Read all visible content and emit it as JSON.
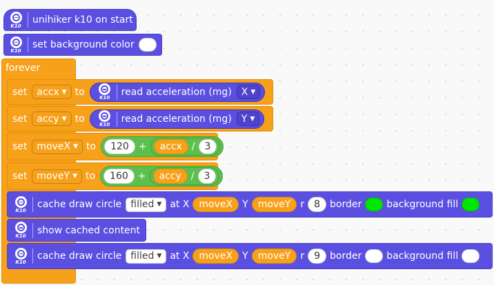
{
  "k10_icon_label": "K10",
  "hat": {
    "label": "unihiker k10 on start"
  },
  "set_bg": {
    "label": "set background color",
    "color": "#ffffff"
  },
  "forever": {
    "label": "forever"
  },
  "set_accx": {
    "set": "set",
    "var": "accx",
    "to": "to",
    "reporter_label": "read acceleration (mg)",
    "axis": "X"
  },
  "set_accy": {
    "set": "set",
    "var": "accy",
    "to": "to",
    "reporter_label": "read acceleration (mg)",
    "axis": "Y"
  },
  "set_movex": {
    "set": "set",
    "var": "moveX",
    "to": "to",
    "a": "120",
    "plus": "+",
    "b": "accx",
    "div": "/",
    "c": "3"
  },
  "set_movey": {
    "set": "set",
    "var": "moveY",
    "to": "to",
    "a": "160",
    "plus": "+",
    "b": "accy",
    "div": "/",
    "c": "3"
  },
  "circle1": {
    "label": "cache draw circle",
    "mode": "filled",
    "atx": "at X",
    "x": "moveX",
    "y_lbl": "Y",
    "y": "moveY",
    "r_lbl": "r",
    "r": "8",
    "border_lbl": "border",
    "border_color": "#00e600",
    "fill_lbl": "background fill",
    "fill_color": "#00e600"
  },
  "show_cached": {
    "label": "show cached content"
  },
  "circle2": {
    "label": "cache draw circle",
    "mode": "filled",
    "atx": "at X",
    "x": "moveX",
    "y_lbl": "Y",
    "y": "moveY",
    "r_lbl": "r",
    "r": "9",
    "border_lbl": "border",
    "border_color": "#ffffff",
    "fill_lbl": "background fill",
    "fill_color": "#ffffff"
  }
}
